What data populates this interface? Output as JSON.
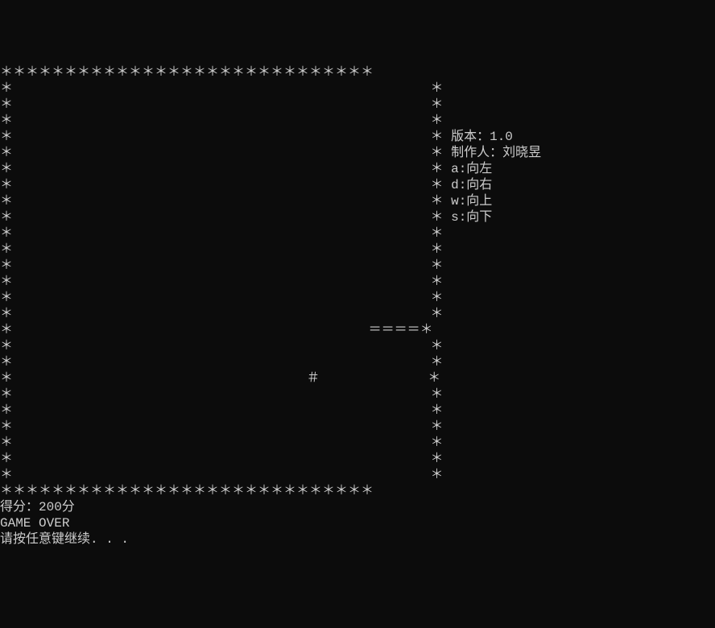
{
  "board": {
    "width": 29,
    "height": 27,
    "border_char": "＊",
    "snake_body_char": "＝",
    "snake_head_char": "＠",
    "food_char": "＃",
    "snake": {
      "body": [
        {
          "row": 16,
          "col": 24
        },
        {
          "row": 16,
          "col": 25
        },
        {
          "row": 16,
          "col": 26
        },
        {
          "row": 16,
          "col": 27
        }
      ],
      "head": {
        "row": 16,
        "col": 28
      }
    },
    "food": {
      "row": 19,
      "col": 20
    }
  },
  "info": {
    "version_label": "版本：",
    "version_value": "1.0",
    "author_label": "制作人：",
    "author_value": "刘晓昱",
    "controls": [
      {
        "key": "a",
        "action": "向左"
      },
      {
        "key": "d",
        "action": "向右"
      },
      {
        "key": "w",
        "action": "向上"
      },
      {
        "key": "s",
        "action": "向下"
      }
    ],
    "info_start_row": 4
  },
  "status": {
    "score_label": "得分：",
    "score_value": "200",
    "score_unit": "分",
    "game_over": "GAME OVER",
    "continue_prompt": "请按任意键继续. . ."
  }
}
